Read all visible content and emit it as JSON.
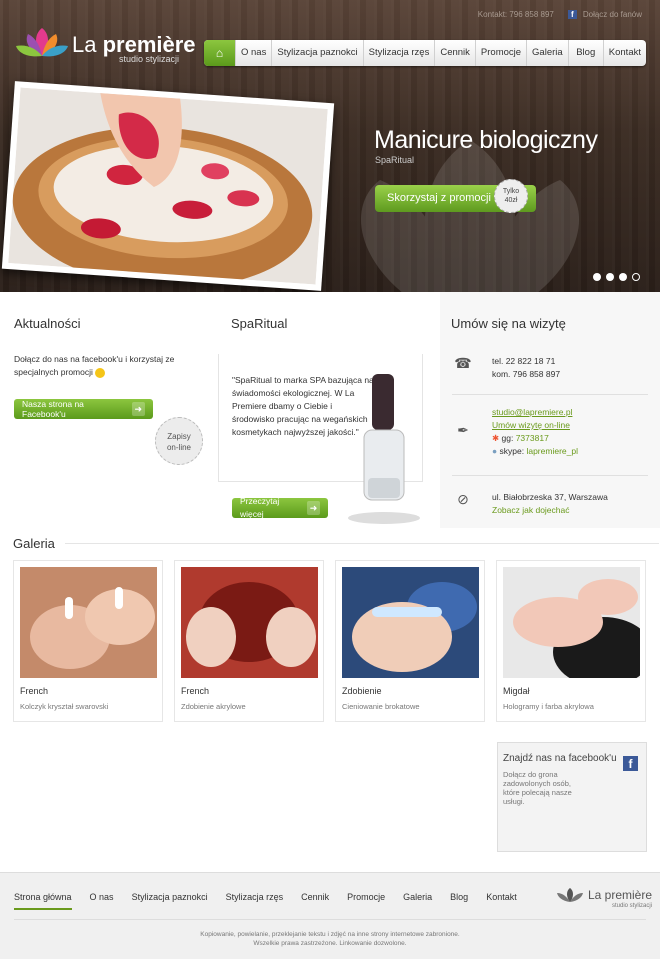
{
  "topbar": {
    "contact": "Kontakt: 796 858 897",
    "fb_link": "Dołącz do fanów"
  },
  "logo": {
    "name_light": "La ",
    "name_bold": "première",
    "subtitle": "studio stylizacji"
  },
  "nav": {
    "items": [
      "O nas",
      "Stylizacja paznokci",
      "Stylizacja rzęs",
      "Cennik",
      "Promocje",
      "Galeria",
      "Blog",
      "Kontakt"
    ]
  },
  "slider": {
    "title": "Manicure biologiczny",
    "subtitle": "SpaRitual",
    "cta": "Skorzystaj z promocji",
    "badge_line1": "Tylko",
    "badge_line2": "40zł",
    "active_slide": 4,
    "slide_count": 4
  },
  "news": {
    "title": "Aktualności",
    "text": "Dołącz do nas na facebook'u i korzystaj ze specjalnych promocji",
    "button": "Nasza strona na Facebook'u"
  },
  "spa": {
    "title": "SpaRitual",
    "text": "\"SpaRitual to marka SPA bazująca na świadomości ekologicznej. W La Premiere dbamy o Ciebie i środowisko pracując na wegańskich kosmetykach najwyższej jakości.\"",
    "button": "Przeczytaj więcej"
  },
  "appointment": {
    "title": "Umów się na wizytę",
    "tel": "tel. 22 822 18 71",
    "kom": "kom. 796 858 897",
    "email": "studio@lapremiere.pl",
    "online": "Umów wizytę on-line",
    "gg_label": "gg:",
    "gg": "7373817",
    "skype_label": "skype:",
    "skype": "lapremiere_pl",
    "badge_line1": "Zapisy",
    "badge_line2": "on-line",
    "address": "ul. Białobrzeska 37, Warszawa",
    "directions": "Zobacz jak dojechać"
  },
  "gallery": {
    "title": "Galeria",
    "items": [
      {
        "title": "French",
        "desc": "Kolczyk kryształ swarovski"
      },
      {
        "title": "French",
        "desc": "Zdobienie akrylowe"
      },
      {
        "title": "Zdobienie",
        "desc": "Cieniowanie brokatowe"
      },
      {
        "title": "Migdał",
        "desc": "Hologramy i farba akrylowa"
      }
    ]
  },
  "fbfind": {
    "title": "Znajdź nas na facebook'u",
    "desc": "Dołącz do grona zadowolonych osób, które polecają nasze usługi."
  },
  "footer": {
    "nav": [
      "Strona główna",
      "O nas",
      "Stylizacja paznokci",
      "Stylizacja rzęs",
      "Cennik",
      "Promocje",
      "Galeria",
      "Blog",
      "Kontakt"
    ],
    "logo_name": "La première",
    "logo_sub": "studio stylizacji",
    "copy1": "Kopiowanie, powielanie, przeklejanie tekstu i zdjęć na inne strony internetowe zabronione.",
    "copy2": "Wszelkie prawa zastrzeżone. Linkowanie dozwolone."
  },
  "colors": {
    "accent_green": "#6a9a1c",
    "header_bg": "#3b2c23",
    "facebook": "#3b5998"
  }
}
